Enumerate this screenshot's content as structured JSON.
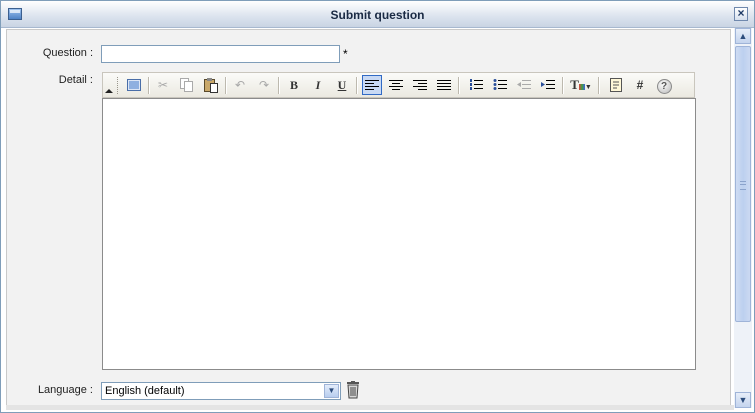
{
  "window": {
    "title": "Submit question"
  },
  "form": {
    "question_label": "Question :",
    "question_value": "",
    "required_marker": "*",
    "detail_label": "Detail :",
    "language_label": "Language :",
    "language_value": "English (default)"
  },
  "toolbar": {
    "bold": "B",
    "italic": "I",
    "underline": "U",
    "anchor": "#",
    "help": "?",
    "text_color": "T",
    "buttons": [
      "toggle-view-icon",
      "cut-icon",
      "copy-icon",
      "paste-icon",
      "undo-icon",
      "redo-icon",
      "bold-icon",
      "italic-icon",
      "underline-icon",
      "align-left-icon",
      "align-center-icon",
      "align-right-icon",
      "justify-icon",
      "ordered-list-icon",
      "unordered-list-icon",
      "outdent-icon",
      "indent-icon",
      "text-color-icon",
      "insert-template-icon",
      "anchor-icon",
      "help-icon"
    ]
  },
  "colors": {
    "accent": "#316ac5",
    "border": "#7f9db9",
    "title_text": "#1a2a44"
  }
}
